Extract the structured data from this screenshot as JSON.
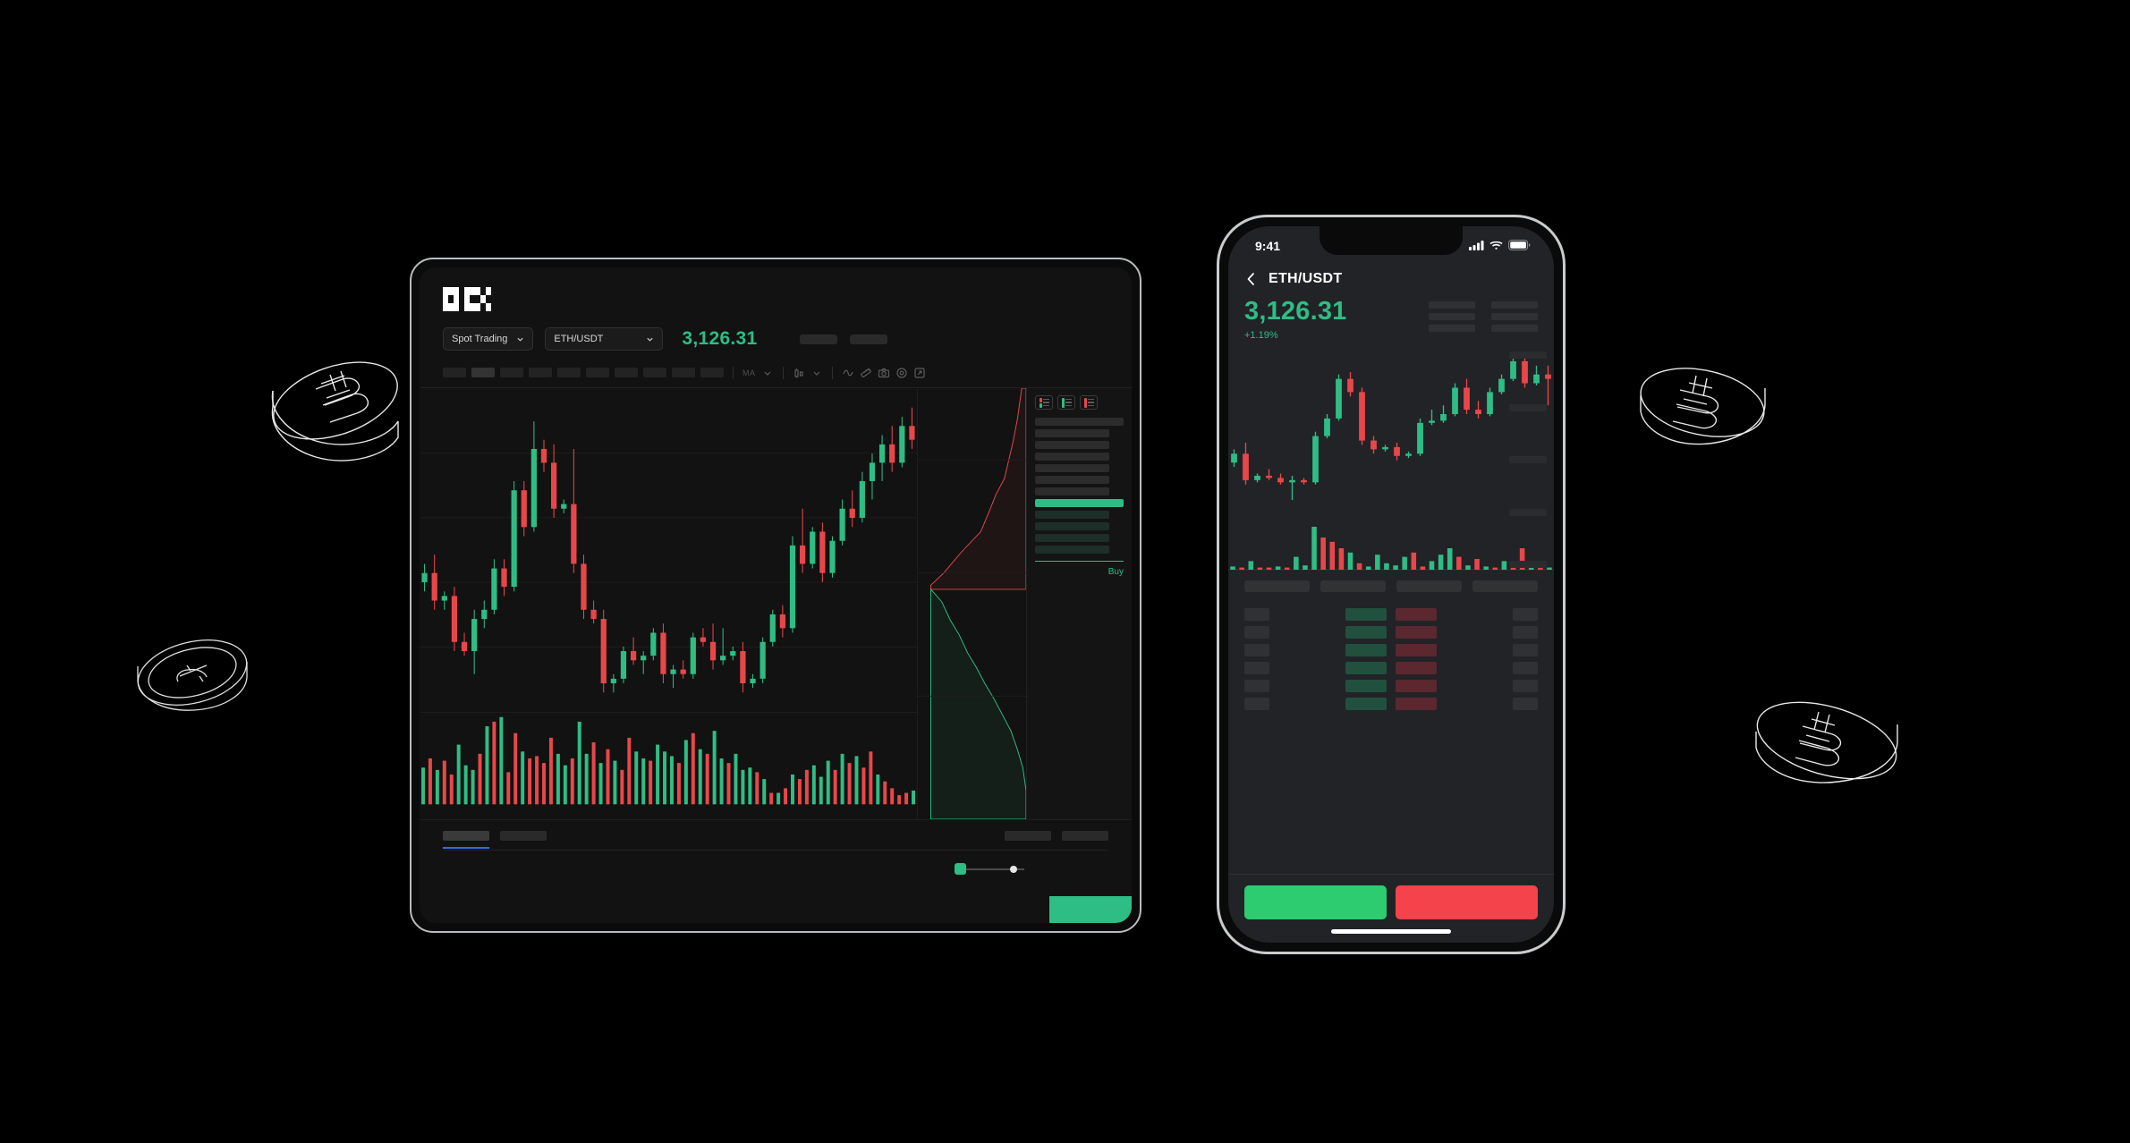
{
  "brand": {
    "logo_name": "okx-logo",
    "name": "OKX"
  },
  "tablet": {
    "spot_trading_label": "Spot Trading",
    "pair_label": "ETH/USDT",
    "price": "3,126.31",
    "toolbar": {
      "ma_label": "MA",
      "icons": [
        "chevron-down-icon",
        "candle-style-icon",
        "chevron-down-icon",
        "indicator-wave-icon",
        "ruler-icon",
        "camera-icon",
        "settings-icon",
        "fullscreen-icon"
      ]
    },
    "orderbook": {
      "buy_label": "Buy"
    }
  },
  "phone": {
    "status": {
      "time": "9:41",
      "signal_icon": "cellular-icon",
      "wifi_icon": "wifi-icon",
      "battery_icon": "battery-icon"
    },
    "nav": {
      "back_icon": "chevron-left-icon",
      "title": "ETH/USDT"
    },
    "price": "3,126.31",
    "change": "+1.19%",
    "buy_label": "",
    "sell_label": ""
  },
  "colors": {
    "up": "#2ebd85",
    "down": "#e8474a",
    "buy_button": "#2ecc71",
    "sell_button": "#f4434a",
    "accent_blue": "#2f6fe0",
    "background": "#000000"
  },
  "chart_data": {
    "type": "candlestick",
    "title": "ETH/USDT",
    "tablet_candles": [
      {
        "o": 28,
        "h": 32,
        "l": 26,
        "c": 30
      },
      {
        "o": 30,
        "h": 34,
        "l": 22,
        "c": 24
      },
      {
        "o": 24,
        "h": 26,
        "l": 22,
        "c": 25
      },
      {
        "o": 25,
        "h": 27,
        "l": 13,
        "c": 15
      },
      {
        "o": 15,
        "h": 17,
        "l": 12,
        "c": 13
      },
      {
        "o": 13,
        "h": 22,
        "l": 8,
        "c": 20
      },
      {
        "o": 20,
        "h": 24,
        "l": 18,
        "c": 22
      },
      {
        "o": 22,
        "h": 33,
        "l": 21,
        "c": 31
      },
      {
        "o": 31,
        "h": 33,
        "l": 25,
        "c": 27
      },
      {
        "o": 27,
        "h": 50,
        "l": 26,
        "c": 48
      },
      {
        "o": 48,
        "h": 50,
        "l": 38,
        "c": 40
      },
      {
        "o": 40,
        "h": 63,
        "l": 39,
        "c": 57
      },
      {
        "o": 57,
        "h": 59,
        "l": 52,
        "c": 54
      },
      {
        "o": 54,
        "h": 58,
        "l": 42,
        "c": 44
      },
      {
        "o": 44,
        "h": 46,
        "l": 43,
        "c": 45
      },
      {
        "o": 45,
        "h": 57,
        "l": 30,
        "c": 32
      },
      {
        "o": 32,
        "h": 34,
        "l": 20,
        "c": 22
      },
      {
        "o": 22,
        "h": 24,
        "l": 19,
        "c": 20
      },
      {
        "o": 20,
        "h": 22,
        "l": 4,
        "c": 6
      },
      {
        "o": 6,
        "h": 8,
        "l": 4,
        "c": 7
      },
      {
        "o": 7,
        "h": 14,
        "l": 6,
        "c": 13
      },
      {
        "o": 13,
        "h": 16,
        "l": 10,
        "c": 11
      },
      {
        "o": 11,
        "h": 13,
        "l": 8,
        "c": 12
      },
      {
        "o": 12,
        "h": 18,
        "l": 11,
        "c": 17
      },
      {
        "o": 17,
        "h": 19,
        "l": 6,
        "c": 8
      },
      {
        "o": 8,
        "h": 10,
        "l": 5,
        "c": 9
      },
      {
        "o": 9,
        "h": 11,
        "l": 7,
        "c": 8
      },
      {
        "o": 8,
        "h": 17,
        "l": 7,
        "c": 16
      },
      {
        "o": 16,
        "h": 18,
        "l": 14,
        "c": 15
      },
      {
        "o": 15,
        "h": 19,
        "l": 9,
        "c": 11
      },
      {
        "o": 11,
        "h": 18,
        "l": 10,
        "c": 12
      },
      {
        "o": 12,
        "h": 14,
        "l": 11,
        "c": 13
      },
      {
        "o": 13,
        "h": 15,
        "l": 4,
        "c": 6
      },
      {
        "o": 6,
        "h": 8,
        "l": 5,
        "c": 7
      },
      {
        "o": 7,
        "h": 16,
        "l": 6,
        "c": 15
      },
      {
        "o": 15,
        "h": 22,
        "l": 14,
        "c": 21
      },
      {
        "o": 21,
        "h": 23,
        "l": 16,
        "c": 18
      },
      {
        "o": 18,
        "h": 38,
        "l": 17,
        "c": 36
      },
      {
        "o": 36,
        "h": 44,
        "l": 30,
        "c": 32
      },
      {
        "o": 32,
        "h": 40,
        "l": 31,
        "c": 39
      },
      {
        "o": 39,
        "h": 41,
        "l": 28,
        "c": 30
      },
      {
        "o": 30,
        "h": 38,
        "l": 29,
        "c": 37
      },
      {
        "o": 37,
        "h": 46,
        "l": 36,
        "c": 44
      },
      {
        "o": 44,
        "h": 48,
        "l": 40,
        "c": 42
      },
      {
        "o": 42,
        "h": 52,
        "l": 41,
        "c": 50
      },
      {
        "o": 50,
        "h": 56,
        "l": 46,
        "c": 54
      },
      {
        "o": 54,
        "h": 60,
        "l": 50,
        "c": 58
      },
      {
        "o": 58,
        "h": 62,
        "l": 52,
        "c": 54
      },
      {
        "o": 54,
        "h": 64,
        "l": 53,
        "c": 62
      },
      {
        "o": 62,
        "h": 66,
        "l": 57,
        "c": 59
      }
    ],
    "tablet_volume": [
      32,
      40,
      30,
      38,
      26,
      52,
      34,
      30,
      44,
      68,
      72,
      76,
      28,
      62,
      46,
      40,
      42,
      36,
      58,
      44,
      34,
      40,
      72,
      44,
      54,
      36,
      48,
      38,
      30,
      58,
      46,
      40,
      38,
      52,
      46,
      42,
      36,
      56,
      62,
      48,
      44,
      64,
      40,
      36,
      44,
      30,
      32,
      28,
      22,
      10,
      10,
      14,
      26,
      22,
      30,
      34,
      24,
      38,
      30,
      44,
      36,
      42,
      32,
      46,
      26,
      20,
      14,
      8,
      10,
      12
    ],
    "phone_candles": [
      {
        "o": 22,
        "h": 28,
        "l": 20,
        "c": 26
      },
      {
        "o": 26,
        "h": 31,
        "l": 12,
        "c": 14
      },
      {
        "o": 14,
        "h": 17,
        "l": 13,
        "c": 16
      },
      {
        "o": 16,
        "h": 19,
        "l": 14,
        "c": 15
      },
      {
        "o": 15,
        "h": 17,
        "l": 12,
        "c": 13
      },
      {
        "o": 13,
        "h": 16,
        "l": 5,
        "c": 14
      },
      {
        "o": 14,
        "h": 15,
        "l": 12,
        "c": 13
      },
      {
        "o": 13,
        "h": 36,
        "l": 12,
        "c": 34
      },
      {
        "o": 34,
        "h": 44,
        "l": 33,
        "c": 42
      },
      {
        "o": 42,
        "h": 62,
        "l": 41,
        "c": 60
      },
      {
        "o": 60,
        "h": 63,
        "l": 52,
        "c": 54
      },
      {
        "o": 54,
        "h": 56,
        "l": 30,
        "c": 32
      },
      {
        "o": 32,
        "h": 34,
        "l": 26,
        "c": 28
      },
      {
        "o": 28,
        "h": 30,
        "l": 27,
        "c": 29
      },
      {
        "o": 29,
        "h": 31,
        "l": 23,
        "c": 25
      },
      {
        "o": 25,
        "h": 27,
        "l": 24,
        "c": 26
      },
      {
        "o": 26,
        "h": 42,
        "l": 25,
        "c": 40
      },
      {
        "o": 40,
        "h": 46,
        "l": 39,
        "c": 41
      },
      {
        "o": 41,
        "h": 48,
        "l": 40,
        "c": 44
      },
      {
        "o": 44,
        "h": 58,
        "l": 43,
        "c": 56
      },
      {
        "o": 56,
        "h": 60,
        "l": 44,
        "c": 46
      },
      {
        "o": 46,
        "h": 50,
        "l": 42,
        "c": 44
      },
      {
        "o": 44,
        "h": 56,
        "l": 43,
        "c": 54
      },
      {
        "o": 54,
        "h": 62,
        "l": 53,
        "c": 60
      },
      {
        "o": 60,
        "h": 70,
        "l": 59,
        "c": 68
      },
      {
        "o": 68,
        "h": 70,
        "l": 56,
        "c": 58
      },
      {
        "o": 58,
        "h": 66,
        "l": 57,
        "c": 62
      },
      {
        "o": 62,
        "h": 66,
        "l": 48,
        "c": 60
      }
    ],
    "phone_volume": [
      3,
      2,
      8,
      2,
      2,
      3,
      2,
      12,
      4,
      40,
      30,
      26,
      20,
      16,
      6,
      3,
      14,
      6,
      4,
      12,
      16,
      3,
      8,
      14,
      20,
      12,
      4,
      10,
      3,
      2,
      8,
      6,
      20,
      6,
      3,
      2
    ]
  }
}
